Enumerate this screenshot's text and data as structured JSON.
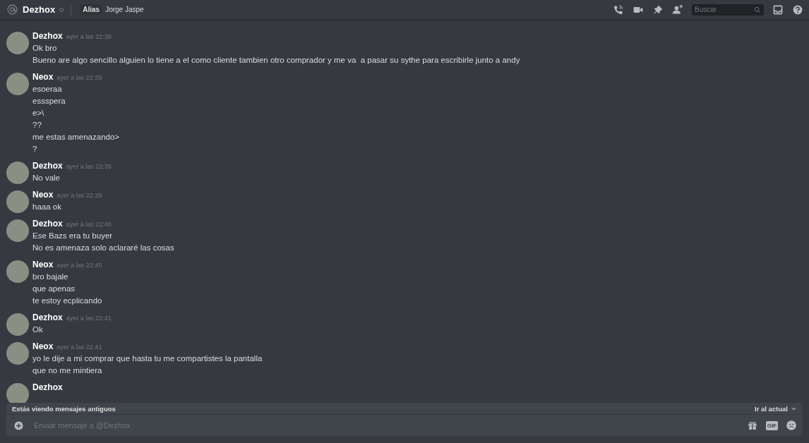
{
  "header": {
    "channel_name": "Dezhox",
    "alias_label": "Alias",
    "alias_value": "Jorge Jaspe",
    "search": {
      "placeholder": "Buscar"
    }
  },
  "messages": [
    {
      "author": "Dezhox",
      "time": "ayer a las 22:39",
      "lines": [
        "Ok bro",
        "Bueno are algo sencillo alguien lo tiene a el como cliente tambien otro comprador y me va  a pasar su sythe para escribirle junto a andy"
      ]
    },
    {
      "author": "Neox",
      "time": "ayer a las 22:39",
      "lines": [
        "esoeraa",
        "essspera",
        "e>\\",
        "??",
        "me estas amenazando>",
        "?"
      ]
    },
    {
      "author": "Dezhox",
      "time": "ayer a las 22:39",
      "lines": [
        "No vale"
      ]
    },
    {
      "author": "Neox",
      "time": "ayer a las 22:39",
      "lines": [
        "haaa ok"
      ]
    },
    {
      "author": "Dezhox",
      "time": "ayer a las 22:40",
      "lines": [
        "Ese Bazs era tu buyer",
        "No es amenaza solo aclararé las cosas"
      ]
    },
    {
      "author": "Neox",
      "time": "ayer a las 22:40",
      "lines": [
        "bro bajale",
        "que apenas",
        "te estoy ecplicando"
      ]
    },
    {
      "author": "Dezhox",
      "time": "ayer a las 22:41",
      "lines": [
        "Ok"
      ]
    },
    {
      "author": "Neox",
      "time": "ayer a las 22:41",
      "lines": [
        "yo le dije a mi comprar que hasta tu me compartistes la pantalla",
        "que no me mintiera"
      ]
    },
    {
      "author": "Dezhox"
    }
  ],
  "banner": {
    "text": "Estás viendo mensajes antiguos",
    "action": "Ir al actual"
  },
  "composer": {
    "placeholder": "Enviar mensaje a @Dezhox",
    "gif_label": "GIF"
  }
}
